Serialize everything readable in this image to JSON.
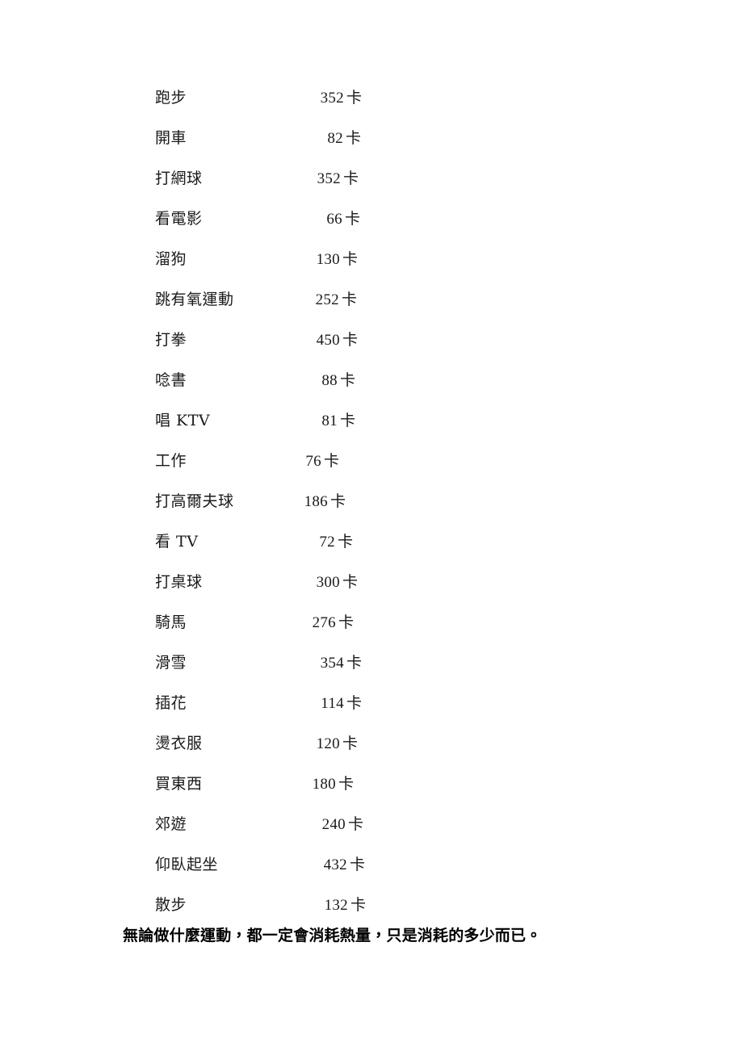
{
  "document": {
    "background_color": "#ffffff",
    "text_color": "#1a1a1a",
    "unit_label": "卡"
  },
  "list": {
    "rows": [
      {
        "label": "跑步",
        "value": "352",
        "unit": "卡"
      },
      {
        "label": "開車",
        "value": "82",
        "unit": "卡"
      },
      {
        "label": "打網球",
        "value": "352",
        "unit": "卡"
      },
      {
        "label": "看電影",
        "value": "66",
        "unit": "卡"
      },
      {
        "label": "溜狗",
        "value": "130",
        "unit": "卡"
      },
      {
        "label": "跳有氧運動",
        "value": "252",
        "unit": "卡"
      },
      {
        "label": "打拳",
        "value": "450",
        "unit": "卡"
      },
      {
        "label": "唸書",
        "value": "88",
        "unit": "卡"
      },
      {
        "label": "唱 KTV",
        "value": "81",
        "unit": "卡"
      },
      {
        "label": "工作",
        "value": "76",
        "unit": "卡"
      },
      {
        "label": "打高爾夫球",
        "value": "186",
        "unit": "卡"
      },
      {
        "label": "看 TV",
        "value": "72",
        "unit": "卡"
      },
      {
        "label": "打桌球",
        "value": "300",
        "unit": "卡"
      },
      {
        "label": "騎馬",
        "value": "276",
        "unit": "卡"
      },
      {
        "label": "滑雪",
        "value": "354",
        "unit": "卡"
      },
      {
        "label": "插花",
        "value": "114",
        "unit": "卡"
      },
      {
        "label": "燙衣服",
        "value": "120",
        "unit": "卡"
      },
      {
        "label": "買東西",
        "value": "180",
        "unit": "卡"
      },
      {
        "label": "郊遊",
        "value": "240",
        "unit": "卡"
      },
      {
        "label": "仰臥起坐",
        "value": "432",
        "unit": "卡"
      },
      {
        "label": "散步",
        "value": "132",
        "unit": "卡"
      }
    ]
  },
  "footer": {
    "note": "無論做什麼運動，都一定會消耗熱量，只是消耗的多少而已。"
  },
  "layout": {
    "row_top_start": 108,
    "row_pitch": 50,
    "label_left": 192,
    "value_right_edges": [
      448,
      447,
      444,
      446,
      443,
      442,
      443,
      440,
      440,
      420,
      428,
      437,
      443,
      438,
      448,
      448,
      443,
      438,
      450,
      452,
      453
    ]
  }
}
